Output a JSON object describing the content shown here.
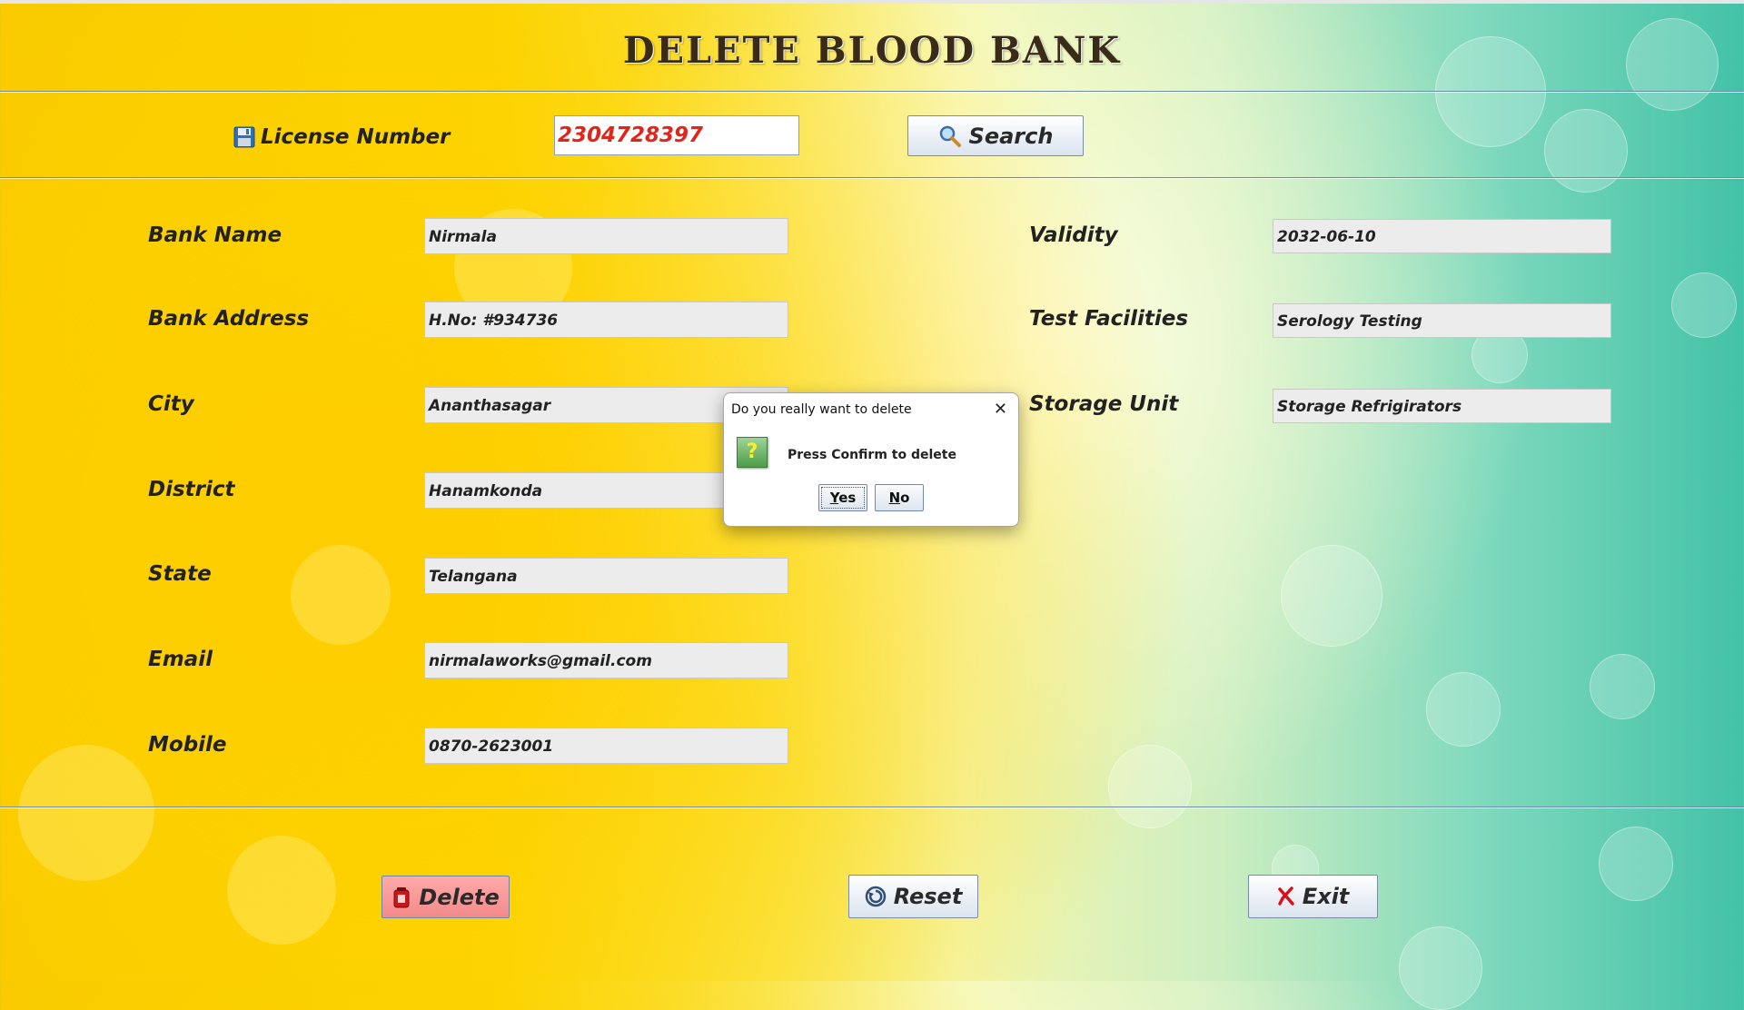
{
  "title": "DELETE BLOOD BANK",
  "license": {
    "label": "License Number",
    "value": "2304728397",
    "search_label": "Search"
  },
  "left_fields": [
    {
      "label": "Bank Name",
      "value": "Nirmala"
    },
    {
      "label": "Bank Address",
      "value": "H.No: #934736"
    },
    {
      "label": "City",
      "value": "Ananthasagar"
    },
    {
      "label": "District",
      "value": "Hanamkonda"
    },
    {
      "label": "State",
      "value": "Telangana"
    },
    {
      "label": "Email",
      "value": "nirmalaworks@gmail.com"
    },
    {
      "label": "Mobile",
      "value": "0870-2623001"
    }
  ],
  "right_fields": [
    {
      "label": "Validity",
      "value": "2032-06-10"
    },
    {
      "label": "Test Facilities",
      "value": "Serology Testing"
    },
    {
      "label": "Storage Unit",
      "value": "Storage Refrigirators"
    }
  ],
  "buttons": {
    "delete": "Delete",
    "reset": "Reset",
    "exit": "Exit"
  },
  "dialog": {
    "title": "Do you really want to delete",
    "message": "Press Confirm to delete",
    "yes_first": "Y",
    "yes_rest": "es",
    "no_first": "N",
    "no_rest": "o",
    "icon": "question-icon"
  },
  "colors": {
    "license_value": "#e0261c",
    "delete_button": "#f38a8a",
    "rule": "#6d8ba8"
  }
}
